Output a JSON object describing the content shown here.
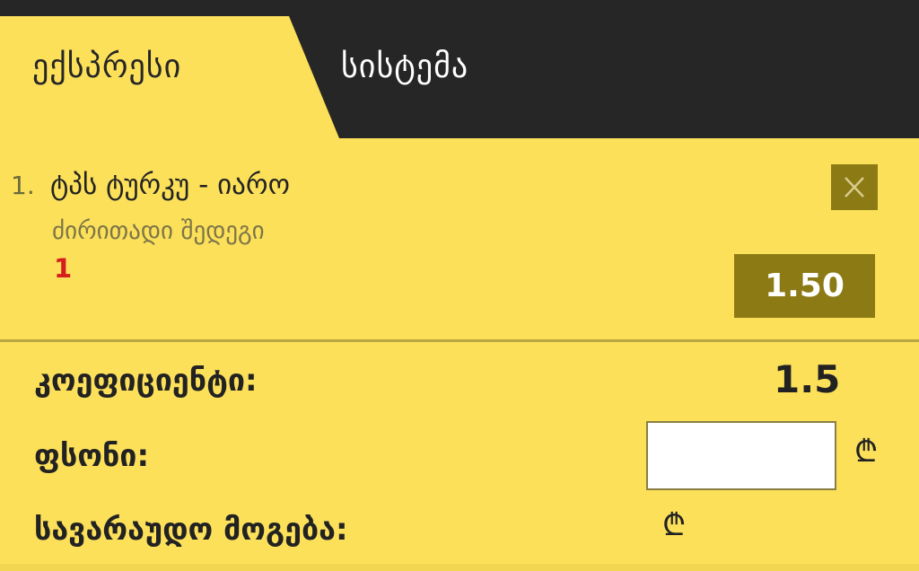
{
  "tabs": {
    "express_label": "ექსპრესი",
    "system_label": "სისტემა"
  },
  "bet": {
    "number": "1.",
    "match": "ტპს ტურკუ - იარო",
    "market": "ძირითადი შედეგი",
    "pick": "1",
    "odds": "1.50"
  },
  "summary": {
    "coefficient_label": "კოეფიციენტი:",
    "coefficient_value": "1.5",
    "stake_label": "ფსონი:",
    "stake_value": "",
    "potential_win_label": "სავარაუდო მოგება:",
    "currency_symbol": "₾"
  },
  "colors": {
    "background": "#fce05a",
    "dark": "#262626",
    "accent": "#8c7a15",
    "pick_red": "#d51e1e"
  },
  "icons": {
    "remove": "close-icon"
  }
}
